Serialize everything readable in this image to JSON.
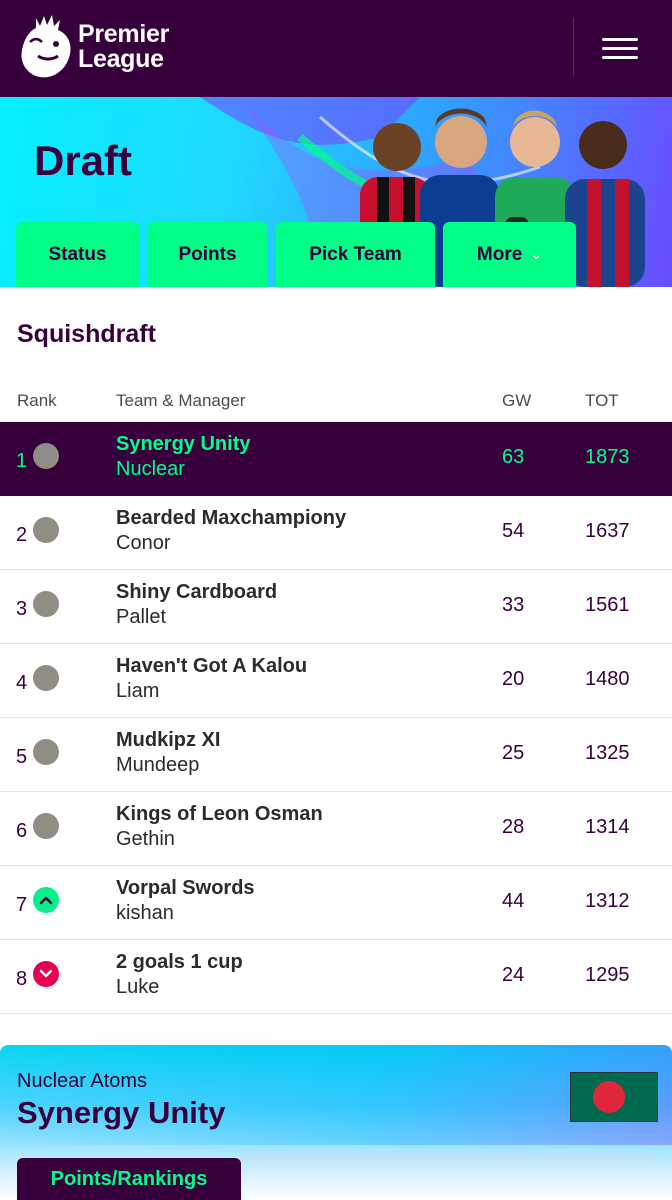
{
  "header": {
    "logo_line1": "Premier",
    "logo_line2": "League"
  },
  "hero": {
    "title": "Draft",
    "tabs": [
      {
        "label": "Status"
      },
      {
        "label": "Points"
      },
      {
        "label": "Pick Team"
      },
      {
        "label": "More"
      }
    ]
  },
  "league": {
    "name": "Squishdraft",
    "columns": {
      "rank": "Rank",
      "team": "Team & Manager",
      "gw": "GW",
      "tot": "TOT"
    },
    "rows": [
      {
        "rank": "1",
        "movement": "same",
        "team": "Synergy Unity",
        "manager": "Nuclear",
        "gw": "63",
        "tot": "1873"
      },
      {
        "rank": "2",
        "movement": "same",
        "team": "Bearded Maxchampiony",
        "manager": "Conor",
        "gw": "54",
        "tot": "1637"
      },
      {
        "rank": "3",
        "movement": "same",
        "team": "Shiny Cardboard",
        "manager": "Pallet",
        "gw": "33",
        "tot": "1561"
      },
      {
        "rank": "4",
        "movement": "same",
        "team": "Haven't Got A Kalou",
        "manager": "Liam",
        "gw": "20",
        "tot": "1480"
      },
      {
        "rank": "5",
        "movement": "same",
        "team": "Mudkipz XI",
        "manager": "Mundeep",
        "gw": "25",
        "tot": "1325"
      },
      {
        "rank": "6",
        "movement": "same",
        "team": "Kings of Leon Osman",
        "manager": "Gethin",
        "gw": "28",
        "tot": "1314"
      },
      {
        "rank": "7",
        "movement": "up",
        "team": "Vorpal Swords",
        "manager": "kishan",
        "gw": "44",
        "tot": "1312"
      },
      {
        "rank": "8",
        "movement": "down",
        "team": "2 goals 1 cup",
        "manager": "Luke",
        "gw": "24",
        "tot": "1295"
      }
    ]
  },
  "entry": {
    "subtitle": "Nuclear Atoms",
    "team_name": "Synergy Unity",
    "flag": "bangladesh-flag",
    "tab_label": "Points/Rankings"
  },
  "colors": {
    "brand_purple": "#37003c",
    "accent_green": "#00ff87",
    "movement_same": "#908d85",
    "movement_up": "#05f08c",
    "movement_down": "#e90052"
  }
}
